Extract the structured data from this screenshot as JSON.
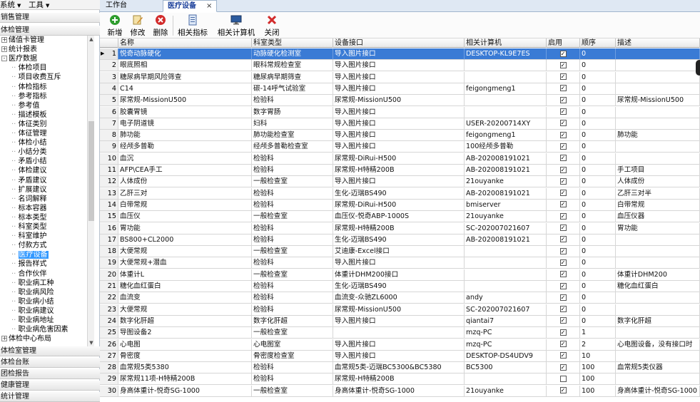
{
  "menubar": {
    "items": [
      "系统",
      "工具"
    ]
  },
  "nav": {
    "sections": [
      "销售管理",
      "体检管理",
      "体检室管理",
      "体检台账",
      "团检报告",
      "健康管理",
      "统计管理"
    ],
    "tree": [
      {
        "label": "储值卡管理",
        "level": 1,
        "expander": "+"
      },
      {
        "label": "统计报表",
        "level": 1,
        "expander": "+"
      },
      {
        "label": "医疗数据",
        "level": 1,
        "expander": "-"
      },
      {
        "label": "体检项目",
        "level": 2
      },
      {
        "label": "项目收费互斥",
        "level": 2
      },
      {
        "label": "体检指标",
        "level": 2
      },
      {
        "label": "参考指标",
        "level": 2
      },
      {
        "label": "参考值",
        "level": 2
      },
      {
        "label": "描述模板",
        "level": 2
      },
      {
        "label": "体征类别",
        "level": 2
      },
      {
        "label": "体征管理",
        "level": 2
      },
      {
        "label": "体检小结",
        "level": 2
      },
      {
        "label": "小结分类",
        "level": 2
      },
      {
        "label": "矛盾小结",
        "level": 2
      },
      {
        "label": "体检建议",
        "level": 2
      },
      {
        "label": "矛盾建议",
        "level": 2
      },
      {
        "label": "扩展建议",
        "level": 2
      },
      {
        "label": "名词解释",
        "level": 2
      },
      {
        "label": "标本容器",
        "level": 2
      },
      {
        "label": "标本类型",
        "level": 2
      },
      {
        "label": "科室类型",
        "level": 2
      },
      {
        "label": "科室维护",
        "level": 2
      },
      {
        "label": "付款方式",
        "level": 2
      },
      {
        "label": "医疗设备",
        "level": 2,
        "selected": true
      },
      {
        "label": "报告样式",
        "level": 2
      },
      {
        "label": "合作伙伴",
        "level": 2
      },
      {
        "label": "职业病工种",
        "level": 2
      },
      {
        "label": "职业病风险",
        "level": 2
      },
      {
        "label": "职业病小结",
        "level": 2
      },
      {
        "label": "职业病建议",
        "level": 2
      },
      {
        "label": "职业病地址",
        "level": 2
      },
      {
        "label": "职业病危害因素",
        "level": 2
      },
      {
        "label": "体检中心布局",
        "level": 1,
        "expander": "+"
      }
    ]
  },
  "tabs": [
    {
      "label": "工作台",
      "active": false
    },
    {
      "label": "医疗设备",
      "active": true,
      "close": "×"
    }
  ],
  "toolbar": {
    "buttons": [
      {
        "label": "新增",
        "icon": "add-icon"
      },
      {
        "label": "修改",
        "icon": "edit-icon"
      },
      {
        "label": "删除",
        "icon": "delete-icon"
      },
      {
        "label": "相关指标",
        "icon": "indicator-icon"
      },
      {
        "label": "相关计算机",
        "icon": "computer-icon"
      },
      {
        "label": "关闭",
        "icon": "close-icon"
      }
    ]
  },
  "grid": {
    "columns": [
      "名称",
      "科室类型",
      "设备接口",
      "相关计算机",
      "启用",
      "顺序",
      "描述"
    ],
    "rows": [
      {
        "n": "1",
        "name": "悦奇动脉硬化",
        "dept": "动脉硬化检测室",
        "iface": "导入图片接口",
        "pc": "DESKTOP-KL9E7ES",
        "en": true,
        "ord": "0",
        "desc": ""
      },
      {
        "n": "2",
        "name": "眼底照相",
        "dept": "眼科常规检查室",
        "iface": "导入图片接口",
        "pc": "",
        "en": true,
        "ord": "0",
        "desc": ""
      },
      {
        "n": "3",
        "name": "糖尿病早期风险筛查",
        "dept": "糖尿病早期筛查",
        "iface": "导入图片接口",
        "pc": "",
        "en": true,
        "ord": "0",
        "desc": ""
      },
      {
        "n": "4",
        "name": "C14",
        "dept": "碳-14呼气试验室",
        "iface": "导入图片接口",
        "pc": "feigongmeng1",
        "en": true,
        "ord": "0",
        "desc": ""
      },
      {
        "n": "5",
        "name": "尿常规-MissionU500",
        "dept": "检验科",
        "iface": "尿常规-MissionU500",
        "pc": "",
        "en": true,
        "ord": "0",
        "desc": "尿常规-MissionU500"
      },
      {
        "n": "6",
        "name": "胶囊胃镜",
        "dept": "数字胃肠",
        "iface": "导入图片接口",
        "pc": "",
        "en": true,
        "ord": "0",
        "desc": ""
      },
      {
        "n": "7",
        "name": "电子阴道镜",
        "dept": "妇科",
        "iface": "导入图片接口",
        "pc": "USER-20200714XY",
        "en": true,
        "ord": "0",
        "desc": ""
      },
      {
        "n": "8",
        "name": "肺功能",
        "dept": "肺功能检查室",
        "iface": "导入图片接口",
        "pc": "feigongmeng1",
        "en": true,
        "ord": "0",
        "desc": "肺功能"
      },
      {
        "n": "9",
        "name": "经颅多普勒",
        "dept": "经颅多普勒检查室",
        "iface": "导入图片接口",
        "pc": "100经颅多普勒",
        "en": true,
        "ord": "0",
        "desc": ""
      },
      {
        "n": "10",
        "name": "血沉",
        "dept": "检验科",
        "iface": "尿常规-DiRui-H500",
        "pc": "AB-202008191021",
        "en": true,
        "ord": "0",
        "desc": ""
      },
      {
        "n": "11",
        "name": "AFP\\CEA手工",
        "dept": "检验科",
        "iface": "尿常规-H特精200B",
        "pc": "AB-202008191021",
        "en": true,
        "ord": "0",
        "desc": "手工项目"
      },
      {
        "n": "12",
        "name": "人体成份",
        "dept": "一般检查室",
        "iface": "导入图片接口",
        "pc": "21ouyanke",
        "en": true,
        "ord": "0",
        "desc": "人体成份"
      },
      {
        "n": "13",
        "name": "乙肝三对",
        "dept": "检验科",
        "iface": "生化-迈瑞BS490",
        "pc": "AB-202008191021",
        "en": true,
        "ord": "0",
        "desc": "乙肝三对半"
      },
      {
        "n": "14",
        "name": "白带常规",
        "dept": "检验科",
        "iface": "尿常规-DiRui-H500",
        "pc": "bmiserver",
        "en": true,
        "ord": "0",
        "desc": "白带常规"
      },
      {
        "n": "15",
        "name": "血压仪",
        "dept": "一般检查室",
        "iface": "血压仪-悦奇ABP-1000S",
        "pc": "21ouyanke",
        "en": true,
        "ord": "0",
        "desc": "血压仪器"
      },
      {
        "n": "16",
        "name": "胃功能",
        "dept": "检验科",
        "iface": "尿常规-H特精200B",
        "pc": "SC-202007021607",
        "en": true,
        "ord": "0",
        "desc": "胃功能"
      },
      {
        "n": "17",
        "name": "BS800+CL2000",
        "dept": "检验科",
        "iface": "生化-迈瑞BS490",
        "pc": "AB-202008191021",
        "en": true,
        "ord": "0",
        "desc": ""
      },
      {
        "n": "18",
        "name": "大便常规",
        "dept": "一般检查室",
        "iface": "艾迪康-Excel接口",
        "pc": "",
        "en": true,
        "ord": "0",
        "desc": ""
      },
      {
        "n": "19",
        "name": "大便常规+潜血",
        "dept": "检验科",
        "iface": "导入图片接口",
        "pc": "",
        "en": true,
        "ord": "0",
        "desc": ""
      },
      {
        "n": "20",
        "name": "体重计L",
        "dept": "一般检查室",
        "iface": "体重计DHM200接口",
        "pc": "",
        "en": true,
        "ord": "0",
        "desc": "体重计DHM200"
      },
      {
        "n": "21",
        "name": "糖化血红蛋白",
        "dept": "检验科",
        "iface": "生化-迈瑞BS490",
        "pc": "",
        "en": true,
        "ord": "0",
        "desc": "糖化血红蛋白"
      },
      {
        "n": "22",
        "name": "血流变",
        "dept": "检验科",
        "iface": "血流变-众驰ZL6000",
        "pc": "andy",
        "en": true,
        "ord": "0",
        "desc": ""
      },
      {
        "n": "23",
        "name": "大便常规",
        "dept": "检验科",
        "iface": "尿常规-MissionU500",
        "pc": "SC-202007021607",
        "en": true,
        "ord": "0",
        "desc": ""
      },
      {
        "n": "24",
        "name": "数字化肝超",
        "dept": "数字化肝超",
        "iface": "导入图片接口",
        "pc": "qiantai7",
        "en": true,
        "ord": "0",
        "desc": "数字化肝超"
      },
      {
        "n": "25",
        "name": "导图设备2",
        "dept": "一般检查室",
        "iface": "",
        "pc": "mzq-PC",
        "en": true,
        "ord": "1",
        "desc": ""
      },
      {
        "n": "26",
        "name": "心电图",
        "dept": "心电图室",
        "iface": "导入图片接口",
        "pc": "mzq-PC",
        "en": true,
        "ord": "2",
        "desc": "心电图设备，没有接口时"
      },
      {
        "n": "27",
        "name": "骨密度",
        "dept": "骨密度检查室",
        "iface": "导入图片接口",
        "pc": "DESKTOP-DS4UDV9",
        "en": true,
        "ord": "10",
        "desc": ""
      },
      {
        "n": "28",
        "name": "血常规5类5380",
        "dept": "检验科",
        "iface": "血常规5类-迈瑞BC5300&BC5380",
        "pc": "BC5300",
        "en": true,
        "ord": "100",
        "desc": "血常规5类仪器"
      },
      {
        "n": "29",
        "name": "尿常规11项-H特精200B",
        "dept": "检验科",
        "iface": "尿常规-H特精200B",
        "pc": "",
        "en": false,
        "ord": "100",
        "desc": ""
      },
      {
        "n": "30",
        "name": "身高体重计-悦奇SG-1000",
        "dept": "一般检查室",
        "iface": "身高体重计-悦奇SG-1000",
        "pc": "21ouyanke",
        "en": true,
        "ord": "100",
        "desc": "身高体重计-悦奇SG-1000"
      }
    ]
  },
  "colors": {
    "selected_row": "#3a7bd5",
    "tab_active_text": "#1a3f9a"
  }
}
